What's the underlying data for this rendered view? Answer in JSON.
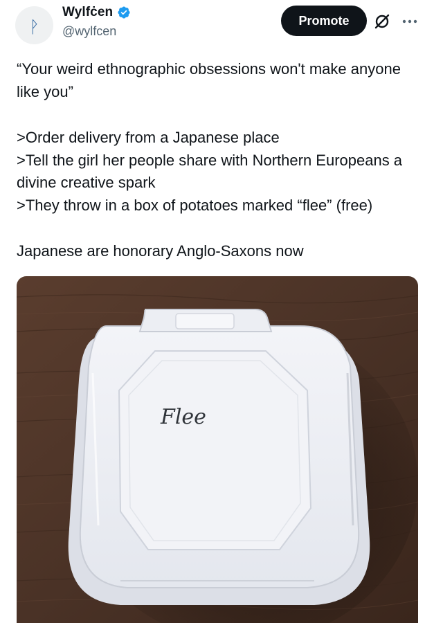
{
  "author": {
    "display_name": "Wylfċen",
    "handle": "@wylfcen",
    "avatar_glyph": "ᚹ",
    "verified": true,
    "verified_color": "#1d9bf0"
  },
  "actions": {
    "promote_label": "Promote",
    "grok_icon": "grok-icon",
    "more_icon": "more-icon"
  },
  "tweet": {
    "lines": [
      "“Your weird ethnographic obsessions won't make anyone like you”",
      ">Order delivery from a Japanese place",
      ">Tell the girl her people share with Northern Europeans a divine creative spark",
      ">They throw in a box of potatoes marked “flee” (free)",
      "Japanese are honorary Anglo-Saxons now"
    ]
  },
  "media": {
    "handwritten_label": "Flee",
    "colors": {
      "table": "#4a3226",
      "box": "#eef0f5"
    }
  }
}
